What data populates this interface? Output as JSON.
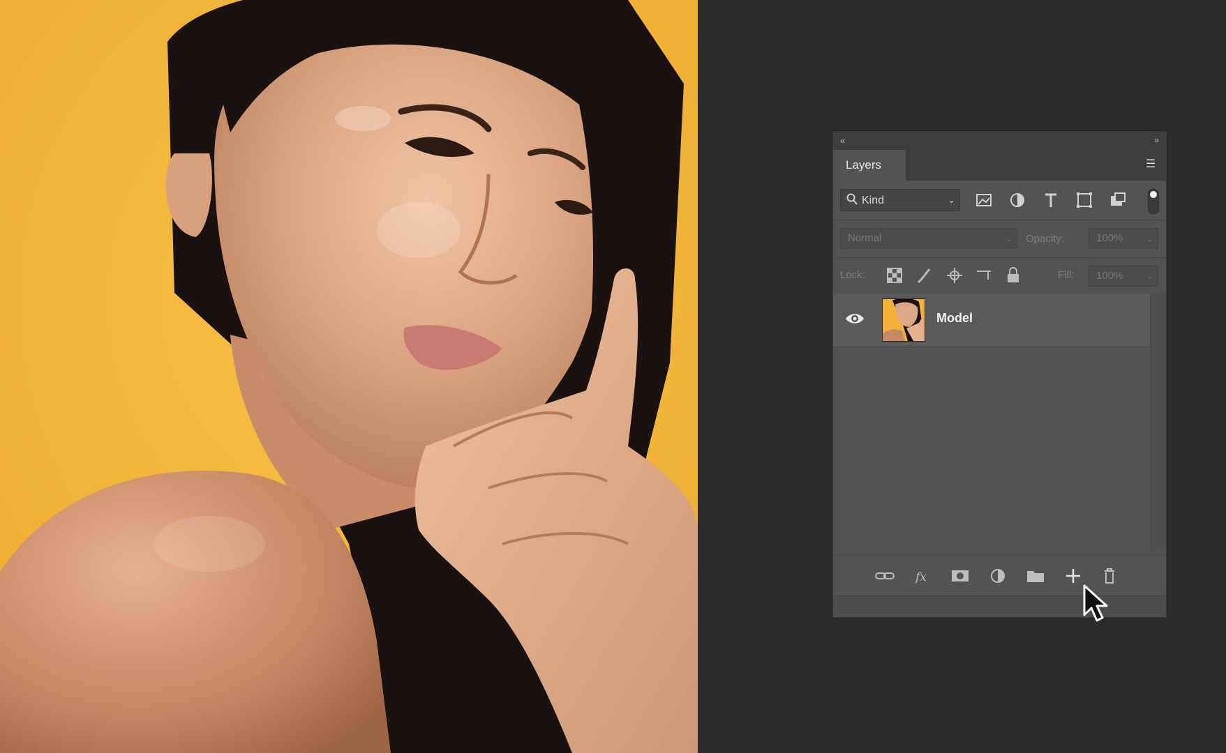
{
  "panel": {
    "tab_label": "Layers",
    "filter": {
      "kind_label": "Kind"
    },
    "blend_mode": "Normal",
    "opacity_label": "Opacity:",
    "opacity_value": "100%",
    "lock_label": "Lock:",
    "fill_label": "Fill:",
    "fill_value": "100%",
    "layers": [
      {
        "name": "Model",
        "visible": true
      }
    ]
  },
  "colors": {
    "background": "#2b2b2b",
    "panel": "#535353",
    "photo_background": "#f4b13a"
  }
}
